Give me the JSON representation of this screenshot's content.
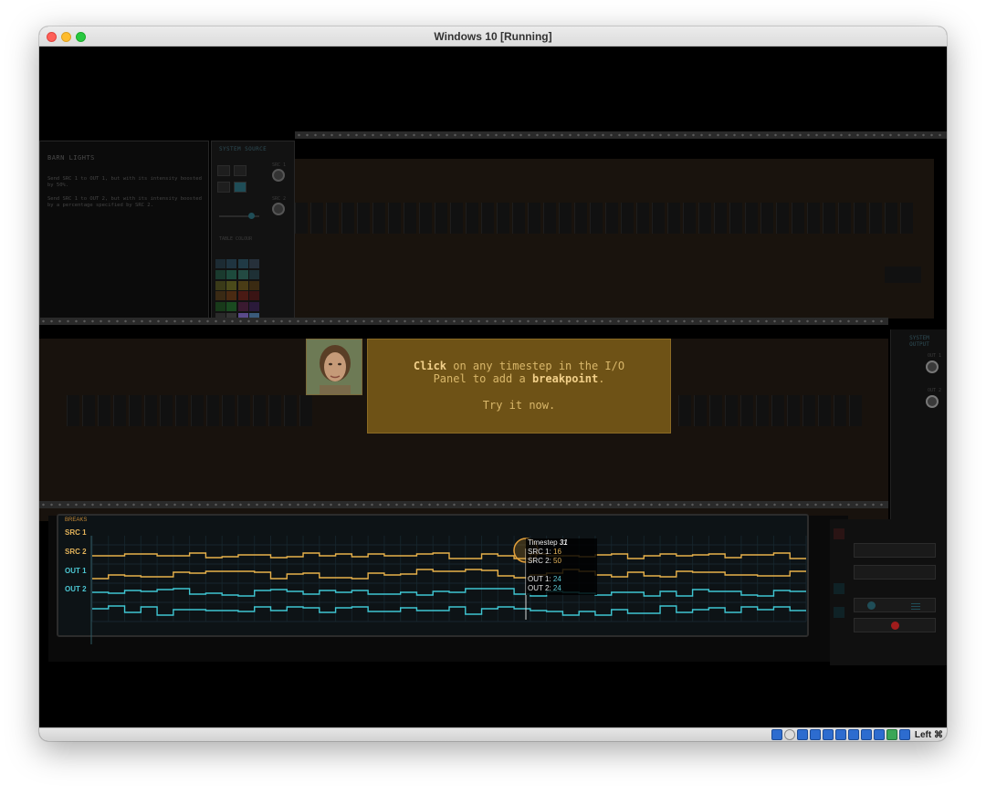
{
  "window": {
    "title": "Windows 10 [Running]"
  },
  "statusbar": {
    "host_key": "Left ⌘"
  },
  "puzzle": {
    "title": "BARN LIGHTS",
    "desc1": "Send SRC 1 to OUT 1, but with its intensity boosted by 50%.",
    "desc2": "Send SRC 1 to OUT 2, but with its intensity boosted by a percentage specified by SRC 2."
  },
  "source": {
    "title": "SYSTEM SOURCE",
    "src1": "SRC 1",
    "src2": "SRC 2",
    "colour_label": "TABLE COLOUR"
  },
  "output": {
    "title": "SYSTEM OUTPUT",
    "out1": "OUT 1",
    "out2": "OUT 2"
  },
  "dialog": {
    "line1_a": "Click",
    "line1_b": " on any timestep in the I/O",
    "line2_a": "Panel to add a ",
    "line2_b": "breakpoint",
    "line2_c": ".",
    "line3": "Try it now."
  },
  "io": {
    "breaks": "BREAKS",
    "labels": [
      "SRC 1",
      "SRC 2",
      "OUT 1",
      "OUT 2"
    ],
    "colors": {
      "src": "#e8b14a",
      "out": "#3fc6d2"
    }
  },
  "tooltip": {
    "timestep_label": "Timestep",
    "timestep": "31",
    "src1_label": "SRC 1:",
    "src1": "16",
    "src2_label": "SRC 2:",
    "src2": "50",
    "out1_label": "OUT 1:",
    "out1": "24",
    "out2_label": "OUT 2:",
    "out2": "24"
  }
}
